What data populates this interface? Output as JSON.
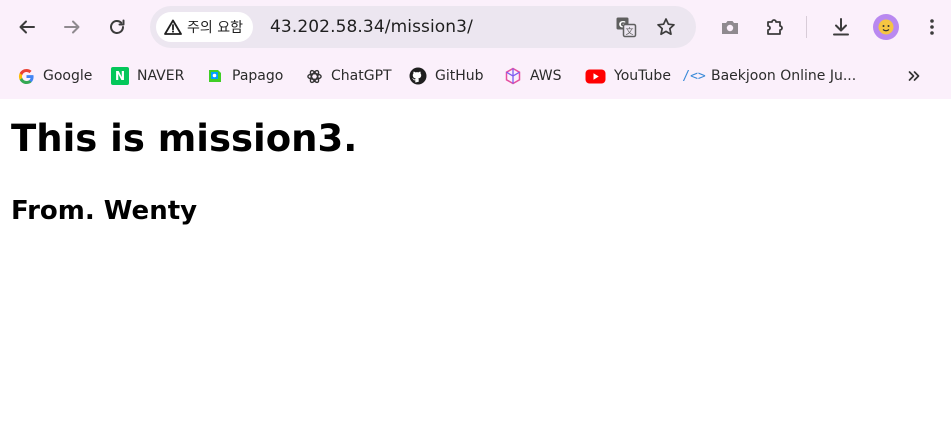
{
  "browser": {
    "security_label": "주의 요함",
    "url": "43.202.58.34/mission3/",
    "icons": {
      "back": "back-arrow-icon",
      "forward": "forward-arrow-icon",
      "reload": "reload-icon",
      "translate": "translate-icon",
      "bookmark_star": "star-icon",
      "screenshot": "camera-icon",
      "extensions": "puzzle-icon",
      "download": "download-icon",
      "menu": "kebab-menu-icon"
    },
    "colors": {
      "chrome_bg": "#fbf0fb",
      "omnibox_bg": "#ece6f0",
      "avatar_bg": "#b989f0"
    }
  },
  "bookmarks": [
    {
      "label": "Google",
      "icon": "google-icon"
    },
    {
      "label": "NAVER",
      "icon": "naver-icon"
    },
    {
      "label": "Papago",
      "icon": "papago-icon"
    },
    {
      "label": "ChatGPT",
      "icon": "chatgpt-icon"
    },
    {
      "label": "GitHub",
      "icon": "github-icon"
    },
    {
      "label": "AWS",
      "icon": "aws-icon"
    },
    {
      "label": "YouTube",
      "icon": "youtube-icon"
    },
    {
      "label": "Baekjoon Online Ju...",
      "icon": "code-icon"
    }
  ],
  "page": {
    "heading": "This is mission3.",
    "subheading": "From. Wenty"
  }
}
